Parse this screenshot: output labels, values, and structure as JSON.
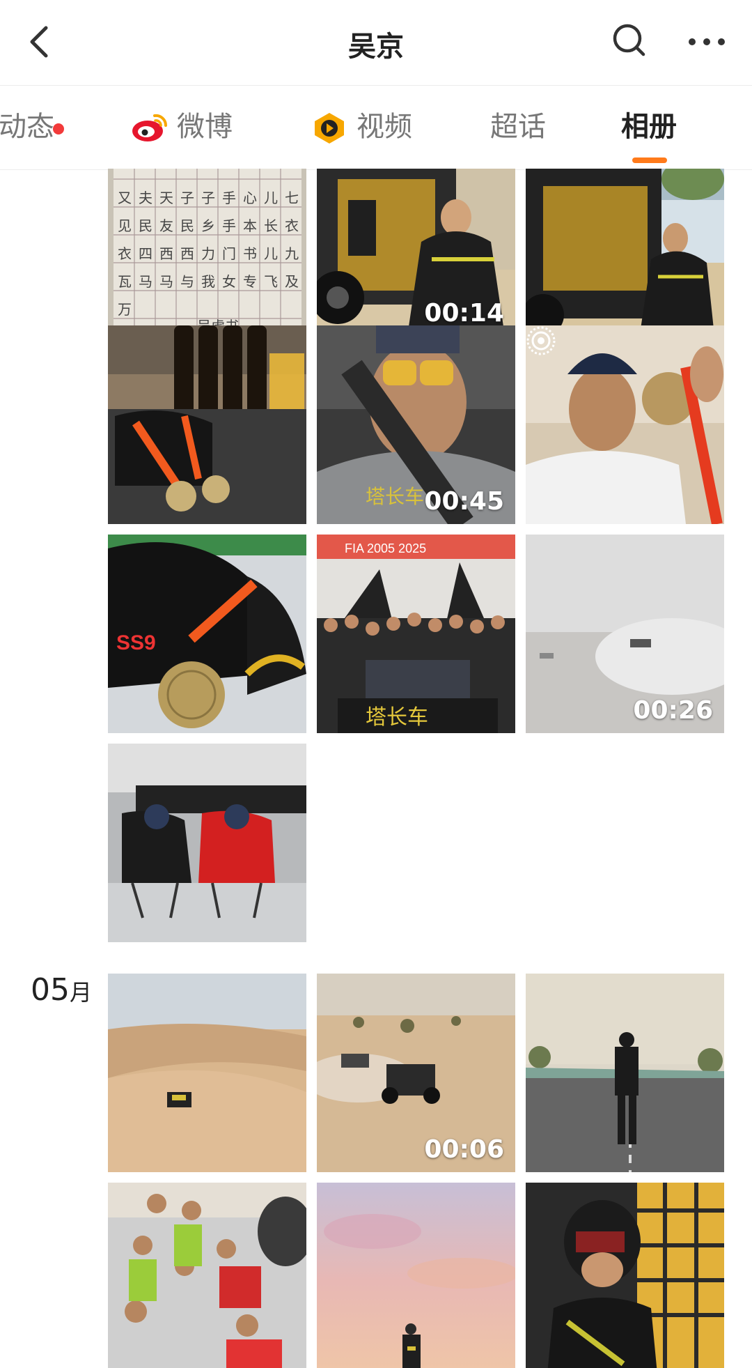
{
  "header": {
    "title": "吴京"
  },
  "tabs": [
    {
      "label": "动态",
      "has_badge": true
    },
    {
      "label": "微博",
      "icon": "weibo-icon"
    },
    {
      "label": "视频",
      "icon": "video-icon"
    },
    {
      "label": "超话"
    },
    {
      "label": "相册",
      "active": true
    }
  ],
  "month_section": {
    "month": "05",
    "unit": "月"
  },
  "tiles": [
    {
      "id": 1,
      "type": "photo",
      "subject": "calligraphy practice sheet",
      "signature": "吴虑书"
    },
    {
      "id": 2,
      "type": "video",
      "duration": "00:14"
    },
    {
      "id": 3,
      "type": "photo"
    },
    {
      "id": 4,
      "type": "photo"
    },
    {
      "id": 5,
      "type": "video",
      "duration": "00:45"
    },
    {
      "id": 6,
      "type": "live_photo"
    },
    {
      "id": 7,
      "type": "photo",
      "cap_text": "SS9"
    },
    {
      "id": 8,
      "type": "photo",
      "banner_text": "FIA 2005 2025",
      "banner_text_2": "塔长车"
    },
    {
      "id": 9,
      "type": "video",
      "duration": "00:26"
    },
    {
      "id": 10,
      "type": "photo"
    },
    {
      "id": 11,
      "type": "photo"
    },
    {
      "id": 12,
      "type": "video",
      "duration": "00:06"
    },
    {
      "id": 13,
      "type": "photo"
    },
    {
      "id": 14,
      "type": "photo"
    },
    {
      "id": 15,
      "type": "photo"
    },
    {
      "id": 16,
      "type": "photo"
    }
  ],
  "colors": {
    "accent": "#ff7a1a",
    "badge": "#f23a3a",
    "weibo_red": "#e6162d",
    "video_orange": "#f7a700"
  }
}
